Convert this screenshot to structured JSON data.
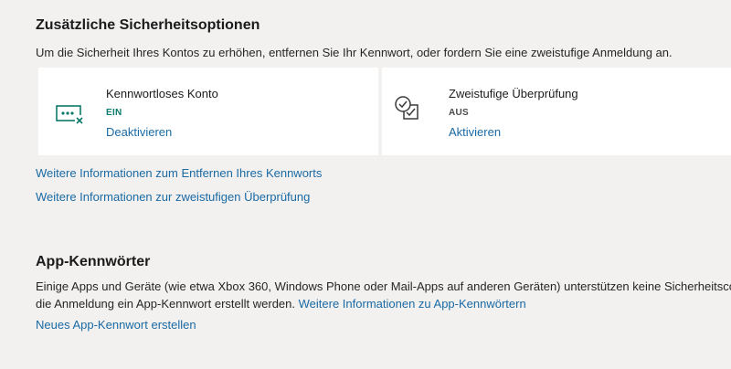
{
  "security_options": {
    "title": "Zusätzliche Sicherheitsoptionen",
    "description": "Um die Sicherheit Ihres Kontos zu erhöhen, entfernen Sie Ihr Kennwort, oder fordern Sie eine zweistufige Anmeldung an.",
    "cards": [
      {
        "icon": "password-dots-remove-icon",
        "title": "Kennwortloses Konto",
        "status": "EIN",
        "status_color": "#0d7a6b",
        "action": "Deaktivieren"
      },
      {
        "icon": "two-step-checkbox-icon",
        "title": "Zweistufige Überprüfung",
        "status": "AUS",
        "status_color": "#4a4a4a",
        "action": "Aktivieren"
      }
    ],
    "links": {
      "remove_password": "Weitere Informationen zum Entfernen Ihres Kennworts",
      "two_step": "Weitere Informationen zur zweistufigen Überprüfung"
    }
  },
  "app_passwords": {
    "title": "App-Kennwörter",
    "description_line1": "Einige Apps und Geräte (wie etwa Xbox 360, Windows Phone oder Mail-Apps auf anderen Geräten) unterstützen keine Sicherheitscodes für d",
    "description_line2": "die Anmeldung ein App-Kennwort erstellt werden.",
    "inline_link": "Weitere Informationen zu App-Kennwörtern",
    "create_link": "Neues App-Kennwort erstellen"
  },
  "colors": {
    "background": "#f2f1f0",
    "card_background": "#ffffff",
    "link": "#1a6aa4",
    "accent_teal": "#0d7a6b"
  }
}
